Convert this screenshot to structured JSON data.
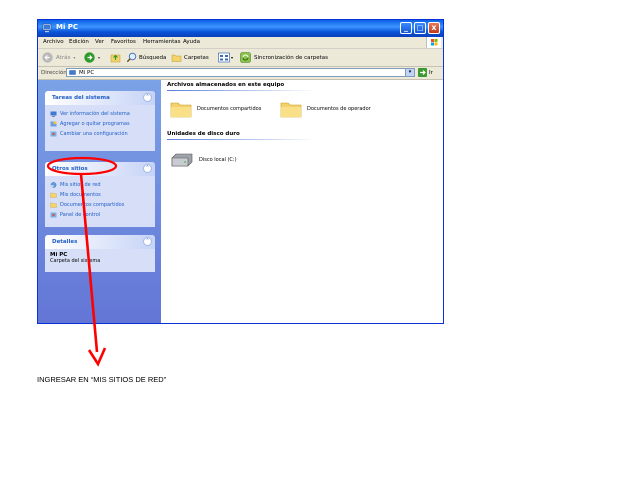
{
  "window": {
    "title": "Mi PC",
    "controls": {
      "minimize": "_",
      "maximize": "□",
      "close": "x"
    }
  },
  "menu": [
    "Archivo",
    "Edición",
    "Ver",
    "Favoritos",
    "Herramientas",
    "Ayuda"
  ],
  "toolbar": {
    "back_label": "Atrás",
    "search_label": "Búsqueda",
    "folders_label": "Carpetas",
    "sync_label": "Sincronización de carpetas"
  },
  "address": {
    "label": "Dirección",
    "value": "Mi PC",
    "go_label": "Ir"
  },
  "tasks_panel": {
    "title": "Tareas del sistema",
    "items": [
      "Ver información del sistema",
      "Agregar o quitar programas",
      "Cambiar una configuración"
    ]
  },
  "other_panel": {
    "title": "Otros sitios",
    "items": [
      "Mis sitios de red",
      "Mis documentos",
      "Documentos compartidos",
      "Panel de control"
    ]
  },
  "details_panel": {
    "title": "Detalles",
    "name": "Mi PC",
    "subtitle": "Carpeta del sistema"
  },
  "content": {
    "section1_title": "Archivos almacenados en este equipo",
    "folders": [
      "Documentos compartidos",
      "Documentos de operador"
    ],
    "section2_title": "Unidades de disco duro",
    "drives": [
      "Disco local (C:)"
    ]
  },
  "annotation": {
    "text": "INGRESAR EN “MIS SITIOS DE RED”",
    "color": "#ff0000"
  },
  "colors": {
    "titlebar": "#0a53d9",
    "sidebar": "#6f8fe0",
    "link": "#215dc6",
    "annotation": "#ff0000"
  }
}
